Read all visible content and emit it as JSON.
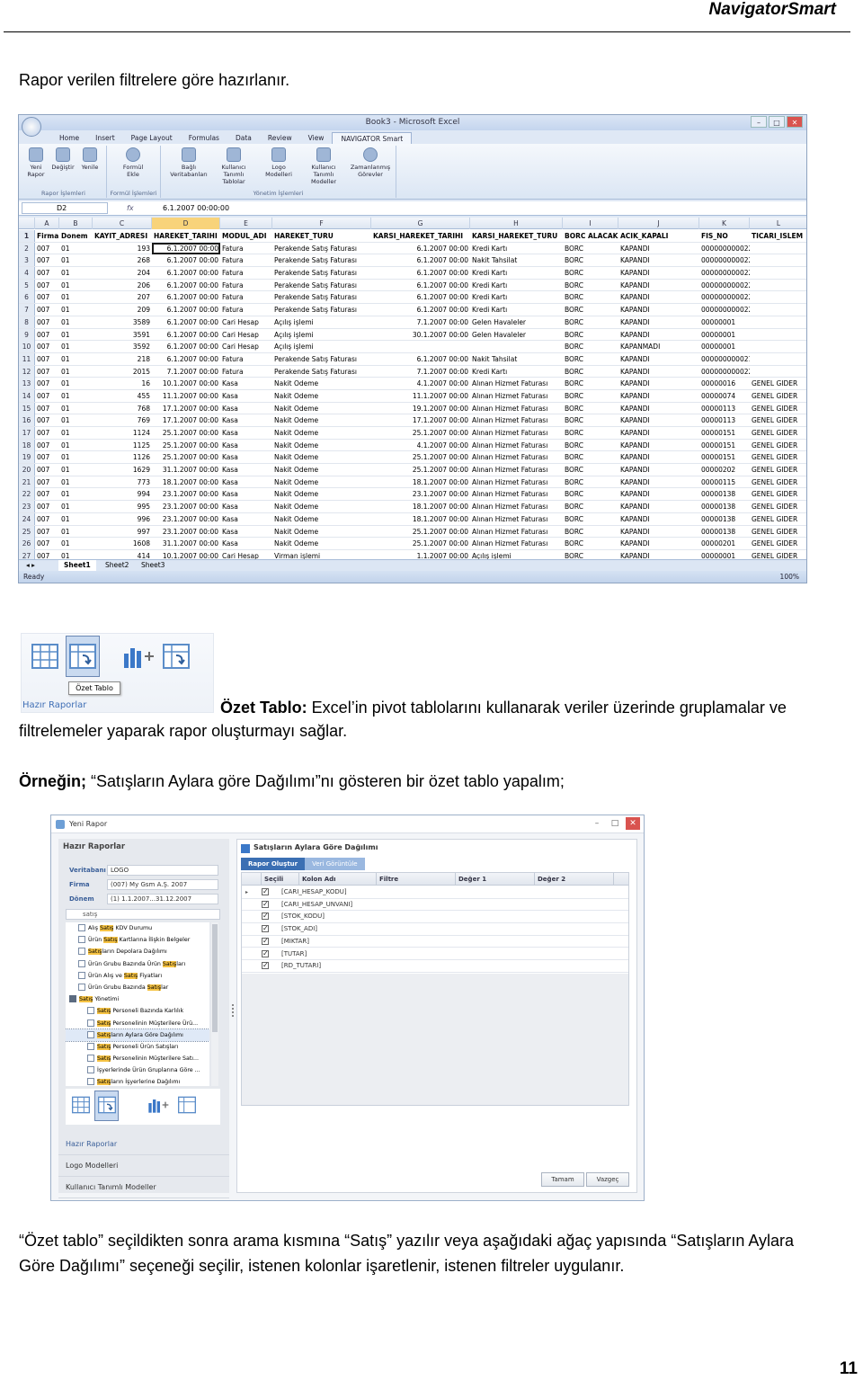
{
  "header": {
    "brand": "NavigatorSmart"
  },
  "intro": "Rapor verilen filtrelere göre hazırlanır.",
  "excel": {
    "window_title": "Book3 - Microsoft Excel",
    "tabs": [
      "Home",
      "Insert",
      "Page Layout",
      "Formulas",
      "Data",
      "Review",
      "View",
      "NAVIGATOR Smart"
    ],
    "ribbon_groups": [
      {
        "label": "Rapor İşlemleri",
        "buttons": [
          "Yeni Rapor",
          "Değiştir",
          "Yenile"
        ]
      },
      {
        "label": "Formül İşlemleri",
        "buttons": [
          "Formül Ekle"
        ]
      },
      {
        "label": "Yönetim İşlemleri",
        "buttons": [
          "Bağlı Veritabanları",
          "Kullanıcı Tanımlı Tablolar",
          "Logo Modelleri",
          "Kullanıcı Tanımlı Modeller",
          "Zamanlanmış Görevler"
        ]
      }
    ],
    "name_box": "D2",
    "formula": "6.1.2007  00:00:00",
    "columns": [
      "A",
      "B",
      "C",
      "D",
      "E",
      "F",
      "G",
      "H",
      "I",
      "J",
      "K",
      "L"
    ],
    "header_row": [
      "Firma",
      "Donem",
      "KAYIT_ADRESI",
      "HAREKET_TARIHI",
      "MODUL_ADI",
      "HAREKET_TURU",
      "KARSI_HAREKET_TARIHI",
      "KARSI_HAREKET_TURU",
      "BORC ALACAK",
      "ACIK_KAPALI",
      "FIS_NO",
      "TICARI_ISLEM"
    ],
    "rows": [
      [
        "2",
        "007",
        "01",
        "193",
        "6.1.2007 00:00",
        "Fatura",
        "Perakende Satış Faturası",
        "6.1.2007 00:00",
        "Kredi Kartı",
        "BORC",
        "KAPANDI",
        "0000000000223",
        ""
      ],
      [
        "3",
        "007",
        "01",
        "268",
        "6.1.2007 00:00",
        "Fatura",
        "Perakende Satış Faturası",
        "6.1.2007 00:00",
        "Nakit Tahsilat",
        "BORC",
        "KAPANDI",
        "0000000000223",
        ""
      ],
      [
        "4",
        "007",
        "01",
        "204",
        "6.1.2007 00:00",
        "Fatura",
        "Perakende Satış Faturası",
        "6.1.2007 00:00",
        "Kredi Kartı",
        "BORC",
        "KAPANDI",
        "0000000000224",
        ""
      ],
      [
        "5",
        "007",
        "01",
        "206",
        "6.1.2007 00:00",
        "Fatura",
        "Perakende Satış Faturası",
        "6.1.2007 00:00",
        "Kredi Kartı",
        "BORC",
        "KAPANDI",
        "0000000000225",
        ""
      ],
      [
        "6",
        "007",
        "01",
        "207",
        "6.1.2007 00:00",
        "Fatura",
        "Perakende Satış Faturası",
        "6.1.2007 00:00",
        "Kredi Kartı",
        "BORC",
        "KAPANDI",
        "0000000000226",
        ""
      ],
      [
        "7",
        "007",
        "01",
        "209",
        "6.1.2007 00:00",
        "Fatura",
        "Perakende Satış Faturası",
        "6.1.2007 00:00",
        "Kredi Kartı",
        "BORC",
        "KAPANDI",
        "0000000000227",
        ""
      ],
      [
        "8",
        "007",
        "01",
        "3589",
        "6.1.2007 00:00",
        "Cari Hesap",
        "Açılış işlemi",
        "7.1.2007 00:00",
        "Gelen Havaleler",
        "BORC",
        "KAPANDI",
        "00000001",
        ""
      ],
      [
        "9",
        "007",
        "01",
        "3591",
        "6.1.2007 00:00",
        "Cari Hesap",
        "Açılış işlemi",
        "30.1.2007 00:00",
        "Gelen Havaleler",
        "BORC",
        "KAPANDI",
        "00000001",
        ""
      ],
      [
        "10",
        "007",
        "01",
        "3592",
        "6.1.2007 00:00",
        "Cari Hesap",
        "Açılış işlemi",
        "",
        "",
        "BORC",
        "KAPANMADI",
        "00000001",
        ""
      ],
      [
        "11",
        "007",
        "01",
        "218",
        "6.1.2007 00:00",
        "Fatura",
        "Perakende Satış Faturası",
        "6.1.2007 00:00",
        "Nakit Tahsilat",
        "BORC",
        "KAPANDI",
        "0000000000215",
        ""
      ],
      [
        "12",
        "007",
        "01",
        "2015",
        "7.1.2007 00:00",
        "Fatura",
        "Perakende Satış Faturası",
        "7.1.2007 00:00",
        "Kredi Kartı",
        "BORC",
        "KAPANDI",
        "0000000000229",
        ""
      ],
      [
        "13",
        "007",
        "01",
        "16",
        "10.1.2007 00:00",
        "Kasa",
        "Nakit Odeme",
        "4.1.2007 00:00",
        "Alınan Hizmet Faturası",
        "BORC",
        "KAPANDI",
        "00000016",
        "GENEL GIDER"
      ],
      [
        "14",
        "007",
        "01",
        "455",
        "11.1.2007 00:00",
        "Kasa",
        "Nakit Odeme",
        "11.1.2007 00:00",
        "Alınan Hizmet Faturası",
        "BORC",
        "KAPANDI",
        "00000074",
        "GENEL GIDER"
      ],
      [
        "15",
        "007",
        "01",
        "768",
        "17.1.2007 00:00",
        "Kasa",
        "Nakit Odeme",
        "19.1.2007 00:00",
        "Alınan Hizmet Faturası",
        "BORC",
        "KAPANDI",
        "00000113",
        "GENEL GIDER"
      ],
      [
        "16",
        "007",
        "01",
        "769",
        "17.1.2007 00:00",
        "Kasa",
        "Nakit Odeme",
        "17.1.2007 00:00",
        "Alınan Hizmet Faturası",
        "BORC",
        "KAPANDI",
        "00000113",
        "GENEL GIDER"
      ],
      [
        "17",
        "007",
        "01",
        "1124",
        "25.1.2007 00:00",
        "Kasa",
        "Nakit Odeme",
        "25.1.2007 00:00",
        "Alınan Hizmet Faturası",
        "BORC",
        "KAPANDI",
        "00000151",
        "GENEL GIDER"
      ],
      [
        "18",
        "007",
        "01",
        "1125",
        "25.1.2007 00:00",
        "Kasa",
        "Nakit Odeme",
        "4.1.2007 00:00",
        "Alınan Hizmet Faturası",
        "BORC",
        "KAPANDI",
        "00000151",
        "GENEL GIDER"
      ],
      [
        "19",
        "007",
        "01",
        "1126",
        "25.1.2007 00:00",
        "Kasa",
        "Nakit Odeme",
        "25.1.2007 00:00",
        "Alınan Hizmet Faturası",
        "BORC",
        "KAPANDI",
        "00000151",
        "GENEL GIDER"
      ],
      [
        "20",
        "007",
        "01",
        "1629",
        "31.1.2007 00:00",
        "Kasa",
        "Nakit Odeme",
        "25.1.2007 00:00",
        "Alınan Hizmet Faturası",
        "BORC",
        "KAPANDI",
        "00000202",
        "GENEL GIDER"
      ],
      [
        "21",
        "007",
        "01",
        "773",
        "18.1.2007 00:00",
        "Kasa",
        "Nakit Odeme",
        "18.1.2007 00:00",
        "Alınan Hizmet Faturası",
        "BORC",
        "KAPANDI",
        "00000115",
        "GENEL GIDER"
      ],
      [
        "22",
        "007",
        "01",
        "994",
        "23.1.2007 00:00",
        "Kasa",
        "Nakit Odeme",
        "23.1.2007 00:00",
        "Alınan Hizmet Faturası",
        "BORC",
        "KAPANDI",
        "00000138",
        "GENEL GIDER"
      ],
      [
        "23",
        "007",
        "01",
        "995",
        "23.1.2007 00:00",
        "Kasa",
        "Nakit Odeme",
        "18.1.2007 00:00",
        "Alınan Hizmet Faturası",
        "BORC",
        "KAPANDI",
        "00000138",
        "GENEL GIDER"
      ],
      [
        "24",
        "007",
        "01",
        "996",
        "23.1.2007 00:00",
        "Kasa",
        "Nakit Odeme",
        "18.1.2007 00:00",
        "Alınan Hizmet Faturası",
        "BORC",
        "KAPANDI",
        "00000138",
        "GENEL GIDER"
      ],
      [
        "25",
        "007",
        "01",
        "997",
        "23.1.2007 00:00",
        "Kasa",
        "Nakit Odeme",
        "25.1.2007 00:00",
        "Alınan Hizmet Faturası",
        "BORC",
        "KAPANDI",
        "00000138",
        "GENEL GIDER"
      ],
      [
        "26",
        "007",
        "01",
        "1608",
        "31.1.2007 00:00",
        "Kasa",
        "Nakit Odeme",
        "25.1.2007 00:00",
        "Alınan Hizmet Faturası",
        "BORC",
        "KAPANDI",
        "00000201",
        "GENEL GIDER"
      ],
      [
        "27",
        "007",
        "01",
        "414",
        "10.1.2007 00:00",
        "Cari Hesap",
        "Virman işlemi",
        "1.1.2007 00:00",
        "Açılış işlemi",
        "BORC",
        "KAPANDI",
        "00000001",
        "GENEL GIDER"
      ]
    ],
    "sheets": [
      "Sheet1",
      "Sheet2",
      "Sheet3"
    ],
    "status": "Ready",
    "zoom": "100%"
  },
  "ozet_button": {
    "tooltip": "Özet Tablo",
    "group_label": "Hazır Raporlar"
  },
  "para1": {
    "bold": "Özet Tablo:",
    "rest_line1": " Excel’in pivot tablolarını kullanarak veriler üzerinde gruplamalar ve",
    "line2": "filtrelemeler yaparak rapor oluşturmayı sağlar."
  },
  "para2": {
    "bold": "Örneğin;",
    "rest": " “Satışların Aylara göre Dağılımı”nı gösteren bir özet tablo yapalım;"
  },
  "dialog": {
    "title": "Yeni Rapor",
    "left_header": "Hazır Raporlar",
    "filters": [
      {
        "label": "Veritabanı",
        "value": "LOGO"
      },
      {
        "label": "Firma",
        "value": "(007) My Gsm A.Ş. 2007"
      },
      {
        "label": "Dönem",
        "value": "(1) 1.1.2007...31.12.2007"
      }
    ],
    "search": "satış",
    "tree": [
      {
        "pre": "Alış ",
        "hl": "Satış",
        "post": " KDV Durumu",
        "indent": 1
      },
      {
        "pre": "Ürün ",
        "hl": "Satış",
        "post": " Kartlarına İlişkin Belgeler",
        "indent": 1
      },
      {
        "pre": "",
        "hl": "Satış",
        "post": "ların Depolara Dağılımı",
        "indent": 1
      },
      {
        "pre": "Ürün Grubu Bazında Ürün ",
        "hl": "Satış",
        "post": "ları",
        "indent": 1
      },
      {
        "pre": "Ürün Alış ve ",
        "hl": "Satış",
        "post": " Fiyatları",
        "indent": 1
      },
      {
        "pre": "Ürün Grubu Bazında ",
        "hl": "Satış",
        "post": "lar",
        "indent": 1
      },
      {
        "pre": "",
        "hl": "Satış",
        "post": " Yönetimi",
        "indent": 0,
        "folder": true
      },
      {
        "pre": "",
        "hl": "Satış",
        "post": " Personeli Bazında Karlılık",
        "indent": 2
      },
      {
        "pre": "",
        "hl": "Satış",
        "post": " Personelinin Müşterilere Ürü...",
        "indent": 2
      },
      {
        "pre": "",
        "hl": "Satış",
        "post": "ların Aylara Göre Dağılımı",
        "indent": 2,
        "selected": true
      },
      {
        "pre": "",
        "hl": "Satış",
        "post": " Personeli Ürün Satışları",
        "indent": 2
      },
      {
        "pre": "",
        "hl": "Satış",
        "post": " Personelinin Müşterilere Satı...",
        "indent": 2
      },
      {
        "pre": "İşyerlerinde Ürün Gruplarına Göre ",
        "hl": "",
        "post": "...",
        "indent": 2
      },
      {
        "pre": "",
        "hl": "Satış",
        "post": "ların İşyerlerine Dağılımı",
        "indent": 2
      }
    ],
    "left_links": [
      "Hazır Raporlar",
      "Logo Modelleri",
      "Kullanıcı Tanımlı Modeller"
    ],
    "right_header": "Satışların Aylara Göre Dağılımı",
    "right_tabs": [
      "Rapor Oluştur",
      "Veri Görüntüle"
    ],
    "grid_headers": [
      "Seçili",
      "Kolon Adı",
      "Filtre",
      "Değer 1",
      "Değer 2"
    ],
    "grid_rows": [
      "[CARI_HESAP_KODU]",
      "[CARI_HESAP_UNVANI]",
      "[STOK_KODU]",
      "[STOK_ADI]",
      "[MIKTAR]",
      "[TUTAR]",
      "[RD_TUTARI]"
    ],
    "buttons": {
      "ok": "Tamam",
      "cancel": "Vazgeç"
    }
  },
  "para3": {
    "line1": "“Özet tablo” seçildikten sonra arama kısmına “Satış” yazılır veya aşağıdaki ağaç yapısında “Satışların Aylara",
    "line2": "Göre Dağılımı” seçeneği seçilir, istenen kolonlar işaretlenir, istenen filtreler uygulanır."
  },
  "page_number": "11"
}
